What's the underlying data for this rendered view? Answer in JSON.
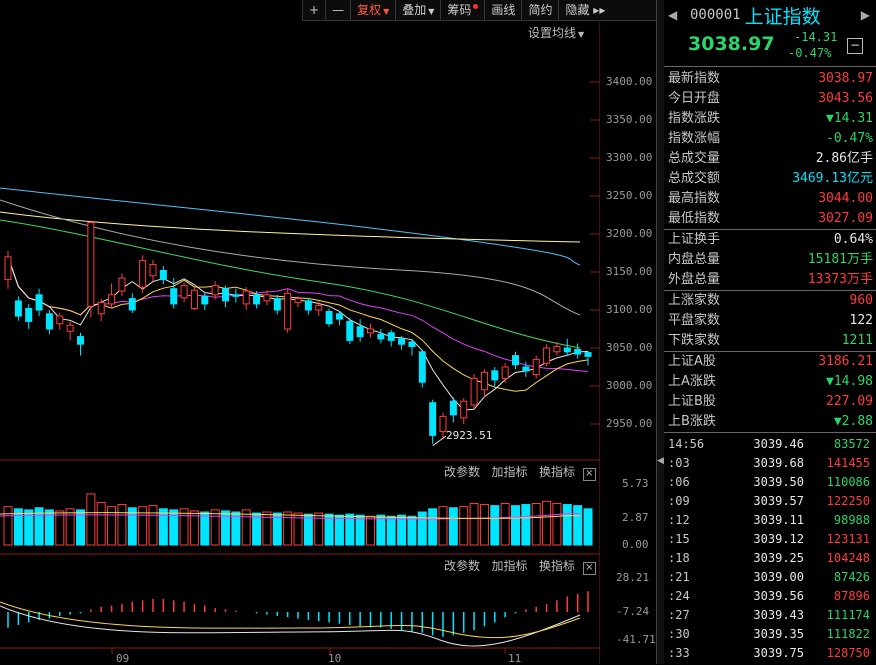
{
  "toolbar": {
    "zoom_in": "+",
    "zoom_out": "—",
    "fuquan": "复权",
    "diejia": "叠加",
    "choума": "筹码",
    "huaxian": "画线",
    "jianyue": "简约",
    "yincang": "隐藏",
    "more": "▸▸"
  },
  "main_chart": {
    "ma_setting": "设置均线",
    "y_ticks": [
      "3400.00",
      "3350.00",
      "3300.00",
      "3250.00",
      "3200.00",
      "3150.00",
      "3100.00",
      "3050.00",
      "3000.00",
      "2950.00"
    ],
    "low_annotation": "2923.51"
  },
  "volume_panel": {
    "param_btn": "改参数",
    "add_indicator": "加指标",
    "switch_indicator": "换指标",
    "close": "×",
    "y_ticks": [
      "5.73",
      "2.87",
      "0.00"
    ]
  },
  "macd_panel": {
    "param_btn": "改参数",
    "add_indicator": "加指标",
    "switch_indicator": "换指标",
    "close": "×",
    "y_ticks": [
      "28.21",
      "-7.24",
      "-41.71"
    ]
  },
  "x_axis": [
    "09",
    "10",
    "11"
  ],
  "colors": {
    "up": "#ff3c3c",
    "down": "#00e5ff",
    "ma5": "#e6e6e6",
    "ma10": "#ffd84a",
    "ma20": "#e040fb",
    "ma30": "#3ddc5c",
    "ma60": "#aaaaaa",
    "ma120": "#4fc3f7",
    "ma250": "#fff59d"
  },
  "header": {
    "code": "000001",
    "name": "上证指数",
    "price": "3038.97",
    "change": "-14.31",
    "change_pct": "-0.47%",
    "toggle": "−"
  },
  "quote": [
    {
      "k": "最新指数",
      "v": "3038.97",
      "c": "red"
    },
    {
      "k": "今日开盘",
      "v": "3043.56",
      "c": "red"
    },
    {
      "k": "指数涨跌",
      "v": "▼14.31",
      "c": "grn"
    },
    {
      "k": "指数涨幅",
      "v": "-0.47%",
      "c": "grn"
    },
    {
      "k": "总成交量",
      "v": "2.86亿手",
      "c": "wht"
    },
    {
      "k": "总成交额",
      "v": "3469.13亿元",
      "c": "cyan"
    },
    {
      "k": "最高指数",
      "v": "3044.00",
      "c": "red"
    },
    {
      "k": "最低指数",
      "v": "3027.09",
      "c": "red"
    }
  ],
  "quote2": [
    {
      "k": "上证换手",
      "v": "0.64%",
      "c": "wht"
    },
    {
      "k": "内盘总量",
      "v": "15181万手",
      "c": "grn"
    },
    {
      "k": "外盘总量",
      "v": "13373万手",
      "c": "red"
    }
  ],
  "quote3": [
    {
      "k": "上涨家数",
      "v": "960",
      "c": "red"
    },
    {
      "k": "平盘家数",
      "v": "122",
      "c": "wht"
    },
    {
      "k": "下跌家数",
      "v": "1211",
      "c": "grn"
    }
  ],
  "quote4": [
    {
      "k": "上证A股",
      "v": "3186.21",
      "c": "red"
    },
    {
      "k": "上A涨跌",
      "v": "▼14.98",
      "c": "grn"
    },
    {
      "k": "上证B股",
      "v": "227.09",
      "c": "red"
    },
    {
      "k": "上B涨跌",
      "v": "▼2.88",
      "c": "grn"
    }
  ],
  "ticks": [
    {
      "t": "14:56",
      "p": "3039.46",
      "v": "83572",
      "c": "grn"
    },
    {
      "t": ":03",
      "p": "3039.68",
      "v": "141455",
      "c": "red"
    },
    {
      "t": ":06",
      "p": "3039.50",
      "v": "110086",
      "c": "grn"
    },
    {
      "t": ":09",
      "p": "3039.57",
      "v": "122250",
      "c": "red"
    },
    {
      "t": ":12",
      "p": "3039.11",
      "v": "98988",
      "c": "grn"
    },
    {
      "t": ":15",
      "p": "3039.12",
      "v": "123131",
      "c": "red"
    },
    {
      "t": ":18",
      "p": "3039.25",
      "v": "104248",
      "c": "red"
    },
    {
      "t": ":21",
      "p": "3039.00",
      "v": "87426",
      "c": "grn"
    },
    {
      "t": ":24",
      "p": "3039.56",
      "v": "87896",
      "c": "red"
    },
    {
      "t": ":27",
      "p": "3039.43",
      "v": "111174",
      "c": "grn"
    },
    {
      "t": ":30",
      "p": "3039.35",
      "v": "111822",
      "c": "grn"
    },
    {
      "t": ":33",
      "p": "3039.75",
      "v": "128750",
      "c": "red"
    }
  ]
}
